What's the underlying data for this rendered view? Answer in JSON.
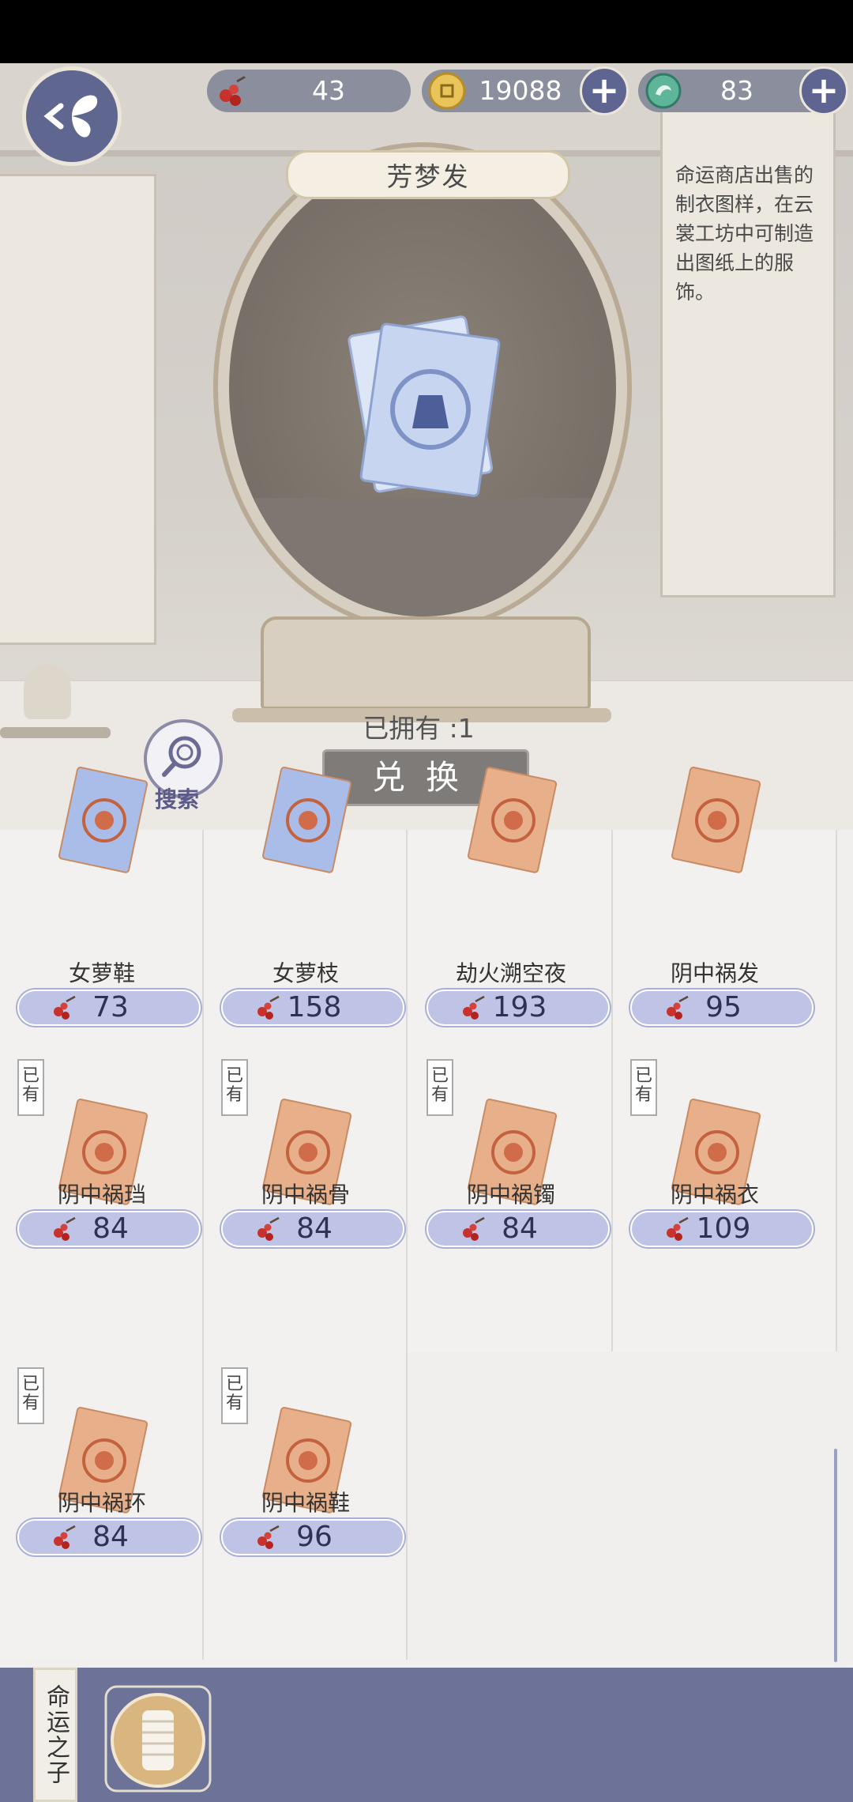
{
  "currencies": {
    "berries": "43",
    "coins": "19088",
    "jade": "83",
    "plus_label": "+"
  },
  "item": {
    "title": "芳梦发",
    "description": "命运商店出售的制衣图样，在云裳工坊中可制造出图纸上的服饰。",
    "owned_text": "已拥有 :1",
    "exchange_label": "兑换"
  },
  "search": {
    "label": "搜索"
  },
  "owned_tag": "已有",
  "grid": [
    {
      "name": "女萝鞋",
      "price": "73",
      "style": "blue",
      "owned": false
    },
    {
      "name": "女萝枝",
      "price": "158",
      "style": "blue",
      "owned": false
    },
    {
      "name": "劫火溯空夜",
      "price": "193",
      "style": "orange",
      "owned": false
    },
    {
      "name": "阴中祸发",
      "price": "95",
      "style": "orange",
      "owned": false
    },
    {
      "name": "阴中祸珰",
      "price": "84",
      "style": "orange",
      "owned": true
    },
    {
      "name": "阴中祸骨",
      "price": "84",
      "style": "orange",
      "owned": true
    },
    {
      "name": "阴中祸镯",
      "price": "84",
      "style": "orange",
      "owned": true
    },
    {
      "name": "阴中祸衣",
      "price": "109",
      "style": "orange",
      "owned": true
    },
    {
      "name": "阴中祸环",
      "price": "84",
      "style": "orange",
      "owned": true
    },
    {
      "name": "阴中祸鞋",
      "price": "96",
      "style": "orange",
      "owned": true
    }
  ],
  "bottom": {
    "tab_label": "命运之子"
  },
  "colors": {
    "accent": "#5e6591",
    "price_bg": "#bfc4e6",
    "orange_paper": "#e7b08a",
    "blue_paper": "#a9bde8"
  }
}
